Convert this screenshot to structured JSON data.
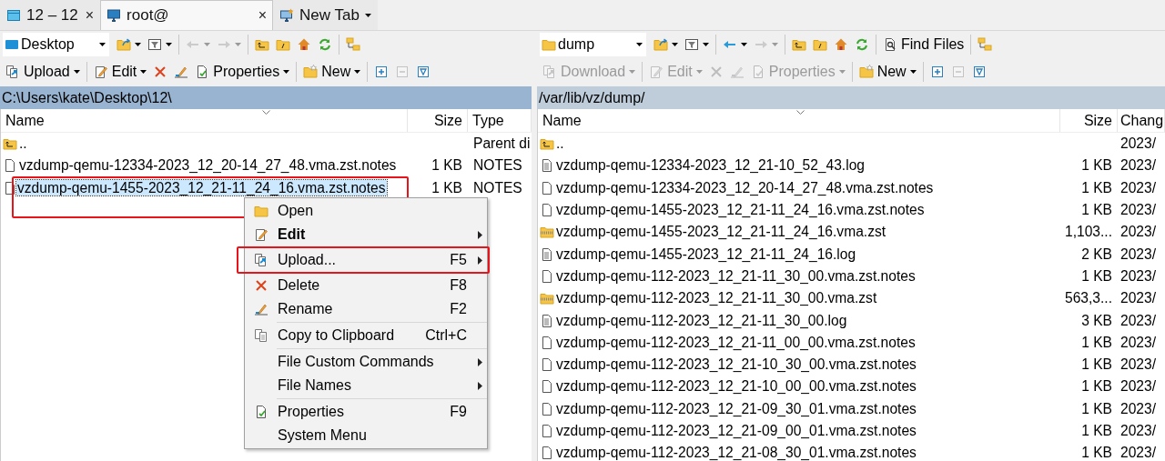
{
  "tabs": [
    {
      "kind": "window",
      "label": "12 – 12",
      "close": "×",
      "selected": false
    },
    {
      "kind": "monitor",
      "label": "root@",
      "close": "×",
      "selected": true
    },
    {
      "kind": "newtab",
      "label": "New Tab",
      "dropdown": true,
      "selected": false
    }
  ],
  "panels": [
    {
      "active": true,
      "toolbar_1": [
        {
          "kind": "desktop",
          "label": "Desktop"
        },
        {
          "kind": "opendir",
          "dropdown": true,
          "disabled": false
        },
        {
          "kind": "filter",
          "dropdown": true,
          "disabled": false
        },
        {
          "kind": "separator"
        },
        {
          "kind": "back",
          "dropdown": true,
          "disabled": true
        },
        {
          "kind": "forward",
          "dropdown": true,
          "disabled": true
        },
        {
          "kind": "separator"
        },
        {
          "kind": "parent",
          "disabled": false
        },
        {
          "kind": "root",
          "disabled": false
        },
        {
          "kind": "home",
          "disabled": false
        },
        {
          "kind": "refresh",
          "disabled": false
        },
        {
          "kind": "separator"
        },
        {
          "kind": "tree",
          "disabled": false
        }
      ],
      "toolbar_2": [
        {
          "kind": "transfer",
          "label": "Upload",
          "dropdown": true,
          "disabled": false
        },
        {
          "kind": "separator"
        },
        {
          "kind": "edit",
          "label": "Edit",
          "dropdown": true,
          "disabled": false
        },
        {
          "kind": "delete",
          "disabled": false
        },
        {
          "kind": "rename",
          "disabled": false
        },
        {
          "kind": "properties",
          "label": "Properties",
          "dropdown": true,
          "disabled": false
        },
        {
          "kind": "separator"
        },
        {
          "kind": "newitem",
          "label": "New",
          "dropdown": true,
          "disabled": false
        },
        {
          "kind": "separator"
        },
        {
          "kind": "plus",
          "disabled": false
        },
        {
          "kind": "minus",
          "disabled": true
        },
        {
          "kind": "select",
          "disabled": false
        }
      ],
      "path": "C:\\Users\\kate\\Desktop\\12\\",
      "columns": [
        "Name",
        "Size",
        "Type"
      ],
      "rows": [
        {
          "kind": "parent",
          "name": "..",
          "type": "Parent di",
          "selected": false,
          "highlighted": false
        },
        {
          "kind": "file",
          "name": "vzdump-qemu-12334-2023_12_20-14_27_48.vma.zst.notes",
          "size": "1 KB",
          "type": "NOTES",
          "selected": false,
          "highlighted": false
        },
        {
          "kind": "file",
          "name": "vzdump-qemu-1455-2023_12_21-11_24_16.vma.zst.notes",
          "size": "1 KB",
          "type": "NOTES",
          "selected": true,
          "highlighted": true
        }
      ]
    },
    {
      "active": false,
      "toolbar_1": [
        {
          "kind": "folder",
          "label": "dump"
        },
        {
          "kind": "opendir",
          "dropdown": true,
          "disabled": false
        },
        {
          "kind": "filter",
          "dropdown": true,
          "disabled": false
        },
        {
          "kind": "separator"
        },
        {
          "kind": "back",
          "dropdown": true,
          "disabled": false
        },
        {
          "kind": "forward",
          "dropdown": true,
          "disabled": true
        },
        {
          "kind": "separator"
        },
        {
          "kind": "parent",
          "disabled": false
        },
        {
          "kind": "root",
          "disabled": false
        },
        {
          "kind": "home",
          "disabled": false
        },
        {
          "kind": "refresh",
          "disabled": false
        },
        {
          "kind": "separator"
        },
        {
          "kind": "find",
          "label": "Find Files",
          "disabled": false
        },
        {
          "kind": "separator"
        },
        {
          "kind": "tree",
          "disabled": false
        }
      ],
      "toolbar_2": [
        {
          "kind": "transfer",
          "label": "Download",
          "dropdown": true,
          "disabled": true
        },
        {
          "kind": "separator"
        },
        {
          "kind": "edit",
          "label": "Edit",
          "dropdown": true,
          "disabled": true
        },
        {
          "kind": "delete",
          "disabled": true
        },
        {
          "kind": "rename",
          "disabled": true
        },
        {
          "kind": "properties",
          "label": "Properties",
          "dropdown": true,
          "disabled": true
        },
        {
          "kind": "separator"
        },
        {
          "kind": "newitem",
          "label": "New",
          "dropdown": true,
          "disabled": false
        },
        {
          "kind": "separator"
        },
        {
          "kind": "plus",
          "disabled": false
        },
        {
          "kind": "minus",
          "disabled": true
        },
        {
          "kind": "select",
          "disabled": false
        }
      ],
      "path": "/var/lib/vz/dump/",
      "columns": [
        "Name",
        "Size",
        "Chang"
      ],
      "rows": [
        {
          "kind": "parent",
          "name": "..",
          "changed": "2023/",
          "selected": false
        },
        {
          "kind": "log",
          "name": "vzdump-qemu-12334-2023_12_21-10_52_43.log",
          "size": "1 KB",
          "changed": "2023/",
          "selected": false
        },
        {
          "kind": "file",
          "name": "vzdump-qemu-12334-2023_12_20-14_27_48.vma.zst.notes",
          "size": "1 KB",
          "changed": "2023/",
          "selected": false
        },
        {
          "kind": "file",
          "name": "vzdump-qemu-1455-2023_12_21-11_24_16.vma.zst.notes",
          "size": "1 KB",
          "changed": "2023/",
          "selected": false
        },
        {
          "kind": "archive",
          "name": "vzdump-qemu-1455-2023_12_21-11_24_16.vma.zst",
          "size": "1,103...",
          "changed": "2023/",
          "selected": false
        },
        {
          "kind": "log",
          "name": "vzdump-qemu-1455-2023_12_21-11_24_16.log",
          "size": "2 KB",
          "changed": "2023/",
          "selected": false
        },
        {
          "kind": "file",
          "name": "vzdump-qemu-112-2023_12_21-11_30_00.vma.zst.notes",
          "size": "1 KB",
          "changed": "2023/",
          "selected": false
        },
        {
          "kind": "archive",
          "name": "vzdump-qemu-112-2023_12_21-11_30_00.vma.zst",
          "size": "563,3...",
          "changed": "2023/",
          "selected": false
        },
        {
          "kind": "log",
          "name": "vzdump-qemu-112-2023_12_21-11_30_00.log",
          "size": "3 KB",
          "changed": "2023/",
          "selected": false
        },
        {
          "kind": "file",
          "name": "vzdump-qemu-112-2023_12_21-11_00_00.vma.zst.notes",
          "size": "1 KB",
          "changed": "2023/",
          "selected": false
        },
        {
          "kind": "file",
          "name": "vzdump-qemu-112-2023_12_21-10_30_00.vma.zst.notes",
          "size": "1 KB",
          "changed": "2023/",
          "selected": false
        },
        {
          "kind": "file",
          "name": "vzdump-qemu-112-2023_12_21-10_00_00.vma.zst.notes",
          "size": "1 KB",
          "changed": "2023/",
          "selected": false
        },
        {
          "kind": "file",
          "name": "vzdump-qemu-112-2023_12_21-09_30_01.vma.zst.notes",
          "size": "1 KB",
          "changed": "2023/",
          "selected": false
        },
        {
          "kind": "file",
          "name": "vzdump-qemu-112-2023_12_21-09_00_01.vma.zst.notes",
          "size": "1 KB",
          "changed": "2023/",
          "selected": false
        },
        {
          "kind": "file",
          "name": "vzdump-qemu-112-2023_12_21-08_30_01.vma.zst.notes",
          "size": "1 KB",
          "changed": "2023/",
          "selected": false
        }
      ]
    }
  ],
  "context_menu": [
    {
      "kind": "open",
      "label": "Open",
      "bold": false,
      "submenu": false,
      "highlighted": false
    },
    {
      "kind": "edit",
      "label": "Edit",
      "bold": true,
      "submenu": true,
      "highlighted": false
    },
    {
      "kind": "transfer",
      "label": "Upload...",
      "shortcut": "F5",
      "bold": false,
      "submenu": true,
      "highlighted": true
    },
    {
      "kind": "delete",
      "label": "Delete",
      "shortcut": "F8",
      "bold": false,
      "submenu": false,
      "highlighted": false
    },
    {
      "kind": "rename",
      "label": "Rename",
      "shortcut": "F2",
      "bold": false,
      "submenu": false,
      "highlighted": false
    },
    {
      "kind": "separator"
    },
    {
      "kind": "copy",
      "label": "Copy to Clipboard",
      "shortcut": "Ctrl+C",
      "bold": false,
      "submenu": false,
      "highlighted": false
    },
    {
      "kind": "separator"
    },
    {
      "kind": "plain",
      "label": "File Custom Commands",
      "bold": false,
      "submenu": true,
      "highlighted": false
    },
    {
      "kind": "plain",
      "label": "File Names",
      "bold": false,
      "submenu": true,
      "highlighted": false
    },
    {
      "kind": "separator"
    },
    {
      "kind": "properties",
      "label": "Properties",
      "shortcut": "F9",
      "bold": false,
      "submenu": false,
      "highlighted": false
    },
    {
      "kind": "plain",
      "label": "System Menu",
      "bold": false,
      "submenu": false,
      "highlighted": false
    }
  ]
}
